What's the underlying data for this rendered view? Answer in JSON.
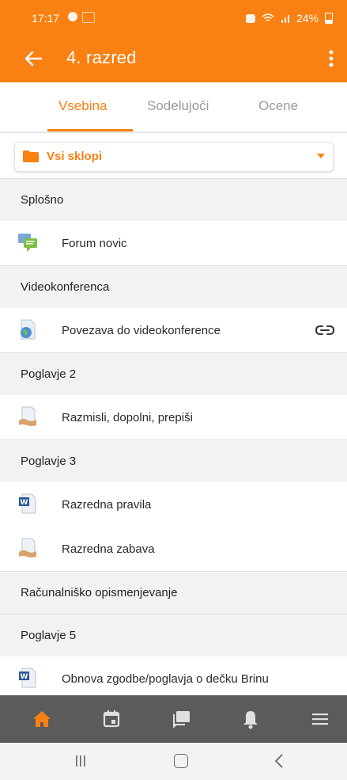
{
  "status_bar": {
    "time": "17:17",
    "battery": "24%"
  },
  "app_bar": {
    "title": "4. razred"
  },
  "tabs": [
    {
      "label": "Vsebina",
      "active": true
    },
    {
      "label": "Sodelujoči",
      "active": false
    },
    {
      "label": "Ocene",
      "active": false
    }
  ],
  "filter": {
    "selected": "Vsi sklopi"
  },
  "sections": [
    {
      "title": "Splošno"
    },
    {
      "title": "Videokonferenca"
    },
    {
      "title": "Poglavje 2"
    },
    {
      "title": "Poglavje 3"
    },
    {
      "title": "Računalniško opismenjevanje"
    },
    {
      "title": "Poglavje 5"
    }
  ],
  "items": [
    {
      "label": "Forum novic",
      "icon": "forum-icon"
    },
    {
      "label": "Povezava do videokonference",
      "icon": "url-icon",
      "trailing_icon": "link-icon"
    },
    {
      "label": "Razmisli, dopolni, prepiši",
      "icon": "assignment-icon"
    },
    {
      "label": "Razredna pravila",
      "icon": "word-document-icon"
    },
    {
      "label": "Razredna zabava",
      "icon": "assignment-icon"
    },
    {
      "label": "Obnova zgodbe/poglavja o dečku Brinu",
      "icon": "word-document-icon"
    }
  ],
  "bottom_nav": [
    "home-icon",
    "calendar-icon",
    "messages-icon",
    "notifications-icon",
    "menu-icon"
  ],
  "colors": {
    "brand": "#f98012",
    "bottom_nav": "#5b5b5b",
    "section_bg": "#f2f2f2"
  }
}
